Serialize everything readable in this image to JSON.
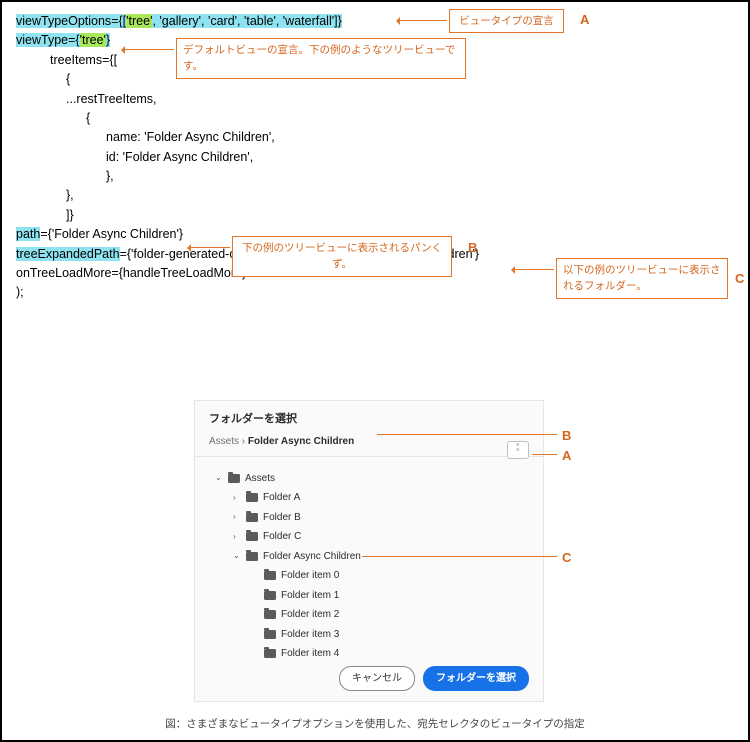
{
  "code": {
    "line1_prefix": "viewTypeOptions",
    "line1_eq": "={[",
    "line1_tree": "'tree'",
    "line1_rest": ", 'gallery', 'card', 'table', 'waterfall']}",
    "line2_prefix": "viewType",
    "line2_eq": "={",
    "line2_tree": "'tree'",
    "line2_close": "}",
    "line3": "treeItems={[",
    "line4": "{",
    "line5": "...restTreeItems,",
    "line6": "{",
    "line7": "name: 'Folder Async Children',",
    "line8": "id: 'Folder Async Children',",
    "line9": "},",
    "line10": "},",
    "line11": "]}",
    "line12_prefix": "path",
    "line12_rest": "={'Folder Async Children'}",
    "line13_prefix": "treeExpandedPath",
    "line13_rest": "={'folder-generated-children-0008675309/Folder Async Children'}",
    "line14": "onTreeLoadMore={handleTreeLoadMore}",
    "line15": ");"
  },
  "callouts": {
    "a": "ビュータイプの宣言",
    "b": "デフォルトビューの宣言。下の例のようなツリービューです。",
    "c": "下の例のツリービューに表示されるパンくず。",
    "d": "以下の例のツリービューに表示されるフォルダー。"
  },
  "letters": {
    "A": "A",
    "B": "B",
    "C": "C"
  },
  "dialog": {
    "title": "フォルダーを選択",
    "breadcrumb_root": "Assets",
    "breadcrumb_sep": " › ",
    "breadcrumb_current": "Folder Async Children",
    "tree": {
      "root": "Assets",
      "folderA": "Folder A",
      "folderB": "Folder B",
      "folderC": "Folder C",
      "async": "Folder Async Children",
      "item0": "Folder item 0",
      "item1": "Folder item 1",
      "item2": "Folder item 2",
      "item3": "Folder item 3",
      "item4": "Folder item 4"
    },
    "buttons": {
      "cancel": "キャンセル",
      "select": "フォルダーを選択"
    }
  },
  "caption": "図：さまざまなビュータイプオプションを使用した、宛先セレクタのビュータイプの指定"
}
